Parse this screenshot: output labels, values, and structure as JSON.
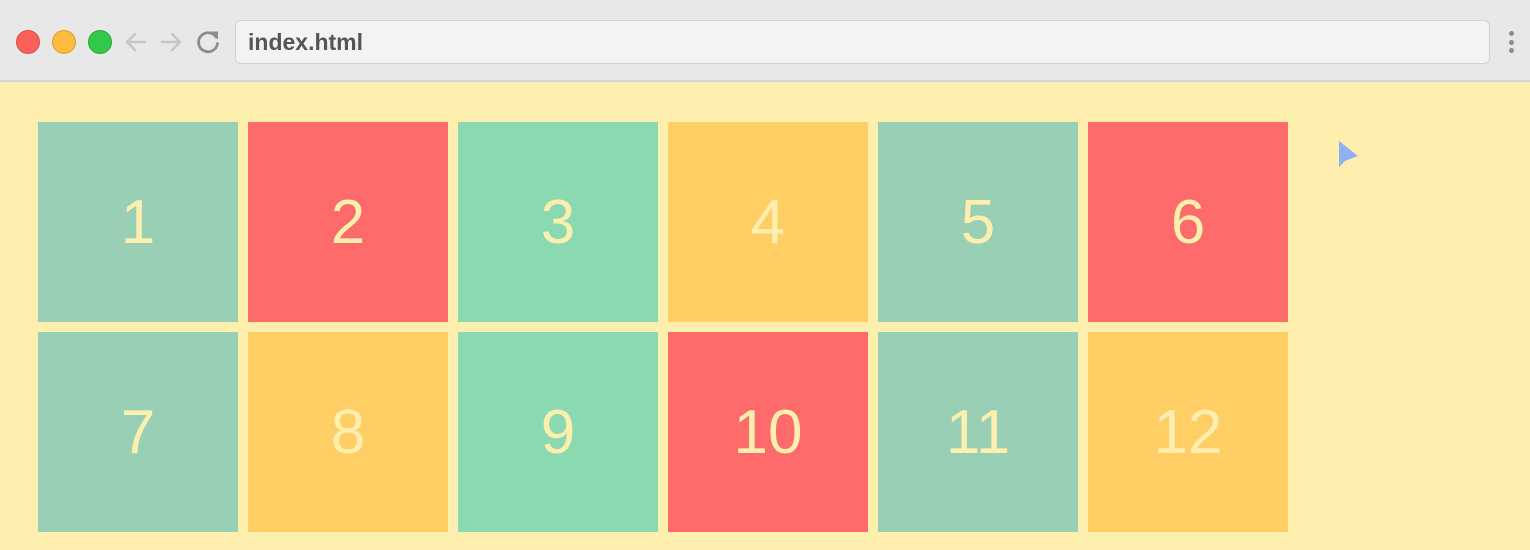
{
  "browser": {
    "address": "index.html",
    "icons": {
      "back": "arrow-left-icon",
      "forward": "arrow-right-icon",
      "reload": "reload-icon",
      "menu": "kebab-menu-icon"
    },
    "traffic_lights": [
      "close",
      "minimize",
      "maximize"
    ]
  },
  "colors": {
    "background": "#FFEFAE",
    "teal": "#98CFB5",
    "red": "#FF6B6B",
    "mint": "#8BD9B0",
    "yellow": "#FFCF66",
    "cursor": "#8FB0F5"
  },
  "grid": {
    "items": [
      {
        "label": "1",
        "color": "#98CFB5"
      },
      {
        "label": "2",
        "color": "#FF6B6B"
      },
      {
        "label": "3",
        "color": "#8BD9B0"
      },
      {
        "label": "4",
        "color": "#FFCF66"
      },
      {
        "label": "5",
        "color": "#98CFB5"
      },
      {
        "label": "6",
        "color": "#FF6B6B"
      },
      {
        "label": "7",
        "color": "#98CFB5"
      },
      {
        "label": "8",
        "color": "#FFCF66"
      },
      {
        "label": "9",
        "color": "#8BD9B0"
      },
      {
        "label": "10",
        "color": "#FF6B6B"
      },
      {
        "label": "11",
        "color": "#98CFB5"
      },
      {
        "label": "12",
        "color": "#FFCF66"
      }
    ]
  }
}
